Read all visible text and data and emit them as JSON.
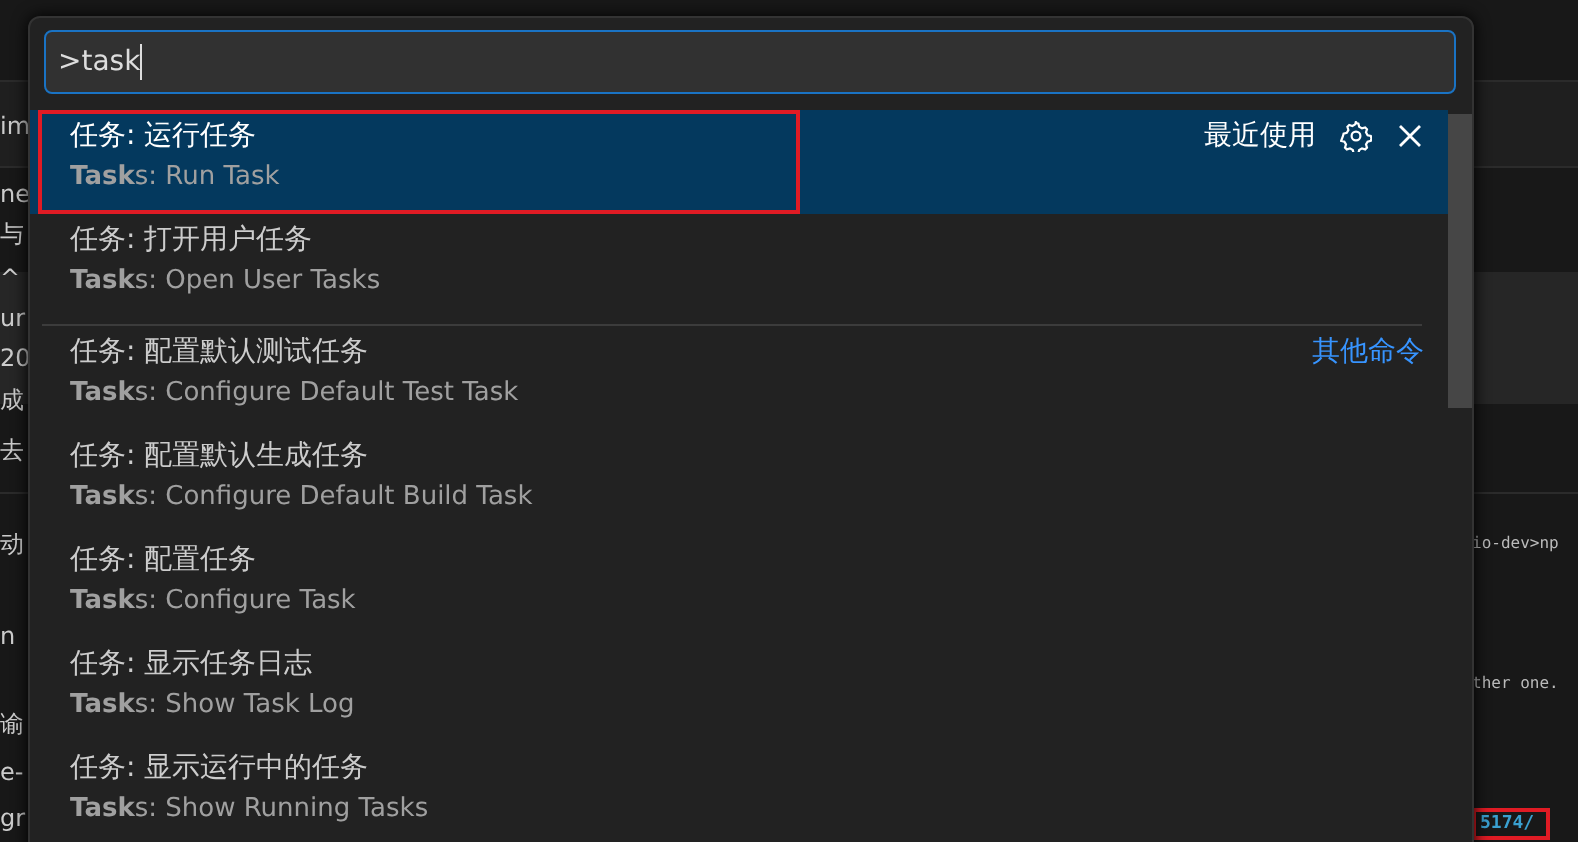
{
  "background": {
    "left_fragments": [
      "im",
      "ne",
      "与",
      "^",
      "ur",
      "20",
      "成",
      "去",
      "动",
      "n",
      "谕",
      "e-",
      "gr"
    ],
    "right_fragments": [
      {
        "text": "io-dev>np",
        "kind": "plain"
      },
      {
        "text": "ther one.",
        "kind": "plain"
      },
      {
        "text": "5174/",
        "kind": "link"
      }
    ]
  },
  "command_palette": {
    "input": {
      "value": ">task"
    },
    "items": [
      {
        "title": "任务: 运行任务",
        "detail": "**Task**s: Run Task",
        "selected": true,
        "badge": "最近使用",
        "separator_before": false,
        "annotated": true
      },
      {
        "title": "任务: 打开用户任务",
        "detail": "**Task**s: Open User Tasks",
        "selected": false,
        "separator_before": false,
        "annotated": false
      },
      {
        "title": "任务: 配置默认测试任务",
        "detail": "**Task**s: Configure Default Test Task",
        "selected": false,
        "badge": "其他命令",
        "separator_before": true,
        "annotated": false
      },
      {
        "title": "任务: 配置默认生成任务",
        "detail": "**Task**s: Configure Default Build Task",
        "selected": false,
        "separator_before": false,
        "annotated": false
      },
      {
        "title": "任务: 配置任务",
        "detail": "**Task**s: Configure Task",
        "selected": false,
        "separator_before": false,
        "annotated": false
      },
      {
        "title": "任务: 显示任务日志",
        "detail": "**Task**s: Show Task Log",
        "selected": false,
        "separator_before": false,
        "annotated": false
      },
      {
        "title": "任务: 显示运行中的任务",
        "detail": "**Task**s: Show Running Tasks",
        "selected": false,
        "separator_before": false,
        "annotated": false
      }
    ]
  }
}
